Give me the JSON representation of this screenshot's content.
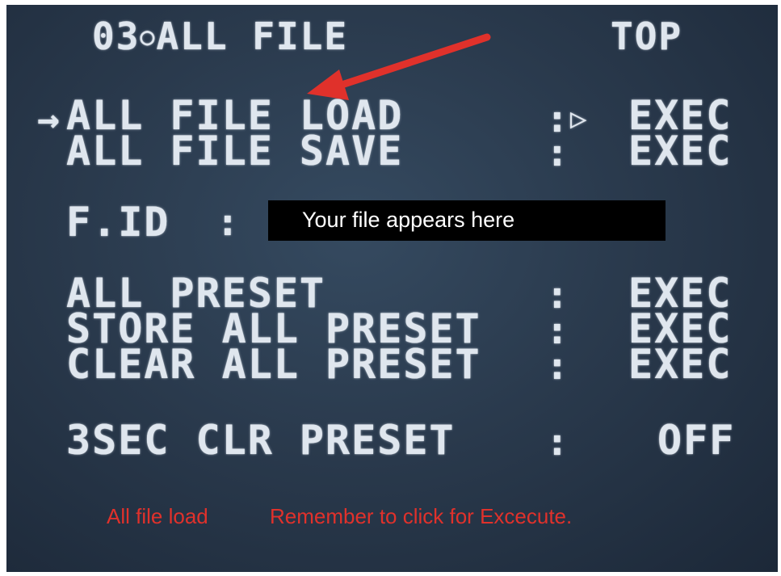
{
  "menu": {
    "number": "03",
    "separator_glyph": "○",
    "title": "ALL FILE",
    "page_indicator": "TOP"
  },
  "cursor_glyph": "→",
  "play_marker_glyph": "▷",
  "items": [
    {
      "label": "ALL FILE LOAD",
      "colon": ":",
      "value": "EXEC",
      "selected": true
    },
    {
      "label": "ALL FILE SAVE",
      "colon": ":",
      "value": "EXEC"
    },
    {
      "label": "ALL PRESET",
      "colon": ":",
      "value": "EXEC"
    },
    {
      "label": "STORE ALL PRESET",
      "colon": ":",
      "value": "EXEC"
    },
    {
      "label": "CLEAR ALL PRESET",
      "colon": ":",
      "value": "EXEC"
    },
    {
      "label": "3SEC CLR PRESET",
      "colon": ":",
      "value": "OFF"
    }
  ],
  "file_id": {
    "label": "F.ID",
    "colon": ":",
    "value": "Your file appears here"
  },
  "annotation": {
    "caption_left": "All file load",
    "caption_right": "Remember to click for Excecute.",
    "arrow_color": "#e0312b"
  }
}
